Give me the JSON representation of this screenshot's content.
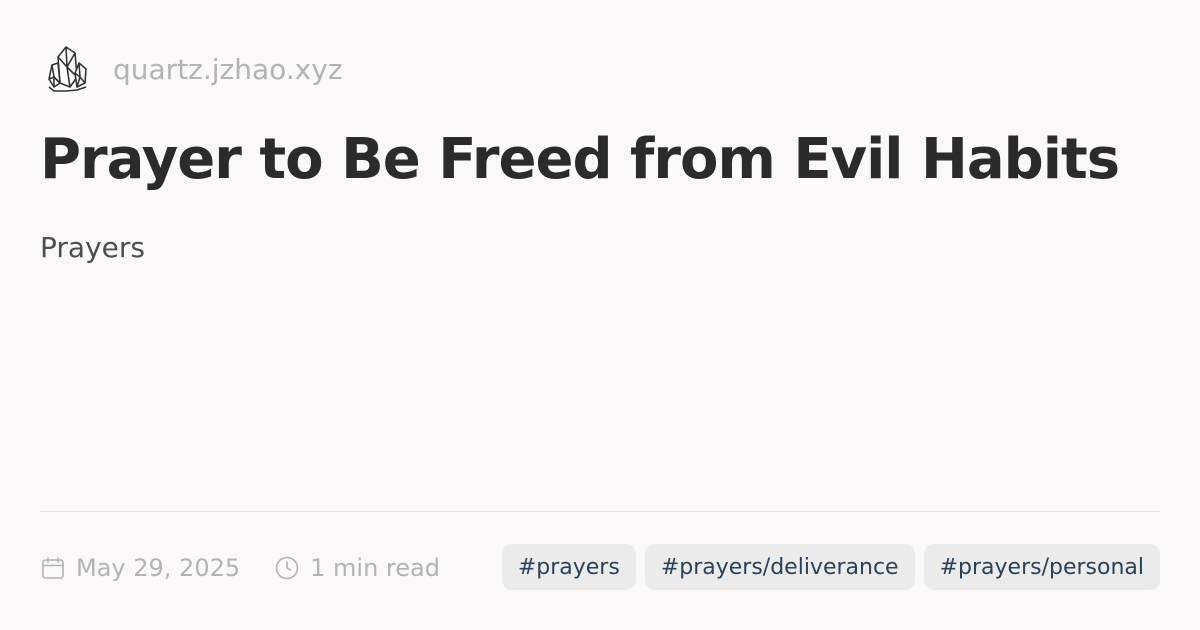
{
  "site": {
    "logo_icon": "crystal-icon",
    "domain": "quartz.jzhao.xyz"
  },
  "page": {
    "title": "Prayer to Be Freed from Evil Habits",
    "description": "Prayers"
  },
  "meta": {
    "date_icon": "calendar-icon",
    "date": "May 29, 2025",
    "reading_time_icon": "clock-icon",
    "reading_time": "1 min read"
  },
  "tags": [
    {
      "label": "#prayers"
    },
    {
      "label": "#prayers/deliverance"
    },
    {
      "label": "#prayers/personal"
    }
  ],
  "colors": {
    "background": "#faf8f8",
    "title": "#2b2b2b",
    "muted": "#b3b3b3",
    "tag_bg": "#ebebec",
    "tag_text": "#2c4156"
  }
}
